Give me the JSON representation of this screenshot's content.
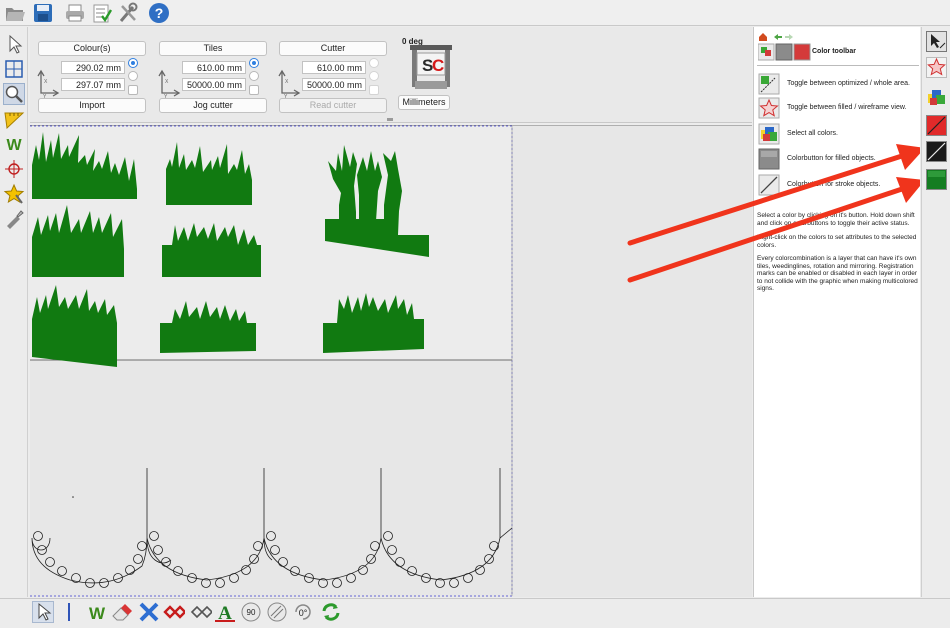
{
  "toolbar": {
    "icons": [
      "folder-open-icon",
      "save-icon",
      "print-icon",
      "checklist-icon",
      "tools-icon",
      "help-icon"
    ]
  },
  "left_tools": [
    "pointer-icon",
    "grid-select-icon",
    "zoom-icon",
    "ruler-icon",
    "weed-icon",
    "crosshair-icon",
    "star-effect-icon",
    "knife-icon"
  ],
  "colour_group": {
    "header": "Colour(s)",
    "x_value": "290.02 mm",
    "y_value": "297.07 mm",
    "button": "Import"
  },
  "tiles_group": {
    "header": "Tiles",
    "x_value": "610.00 mm",
    "y_value": "50000.00 mm",
    "button": "Jog cutter"
  },
  "cutter_group": {
    "header": "Cutter",
    "x_value": "610.00 mm",
    "y_value": "50000.00 mm",
    "button": "Read cutter"
  },
  "machine": {
    "angle": "0 deg",
    "logo": "SC",
    "units_button": "Millimeters"
  },
  "right_panel": {
    "title": "Color toolbar",
    "rows": [
      "Toggle between optimized / whole area.",
      "Toggle between filled / wireframe view.",
      "Select all colors.",
      "Colorbutton for filled objects.",
      "Colorbutton for stroke objects."
    ],
    "help_text": [
      "Select a color by clicking on it's button. Hold down shift and click on colorbuttons to toggle their active status.",
      "Right-click on the colors to set attributes to the selected colors.",
      "Every colorcombination is a layer that can have it's own tiles, weedinglines, rotation and mirroring. Registration marks can be enabled or disabled in each layer in order to not collide with the graphic when making multicolored signs."
    ]
  },
  "right_tools": [
    "select-tool-icon",
    "star-wireframe-icon",
    "select-all-colors-icon",
    "red-stroke-color-button",
    "black-stroke-color-button",
    "green-fill-color-button"
  ],
  "bottom_tools": [
    "pointer-icon",
    "weed-icon",
    "eraser-icon",
    "delete-x-icon",
    "node-red-icon",
    "node-outline-icon",
    "text-icon",
    "rotate-90-icon",
    "hatch-icon",
    "rotate-0-icon",
    "refresh-icon"
  ],
  "bottom_labels": {
    "rot90": "90",
    "rot0": "0°"
  },
  "colors": {
    "green_fill": "#117a11",
    "arrow_red": "#f0341c",
    "selection_dash": "#3a3ad0",
    "radio_blue": "#2f7fe0"
  }
}
